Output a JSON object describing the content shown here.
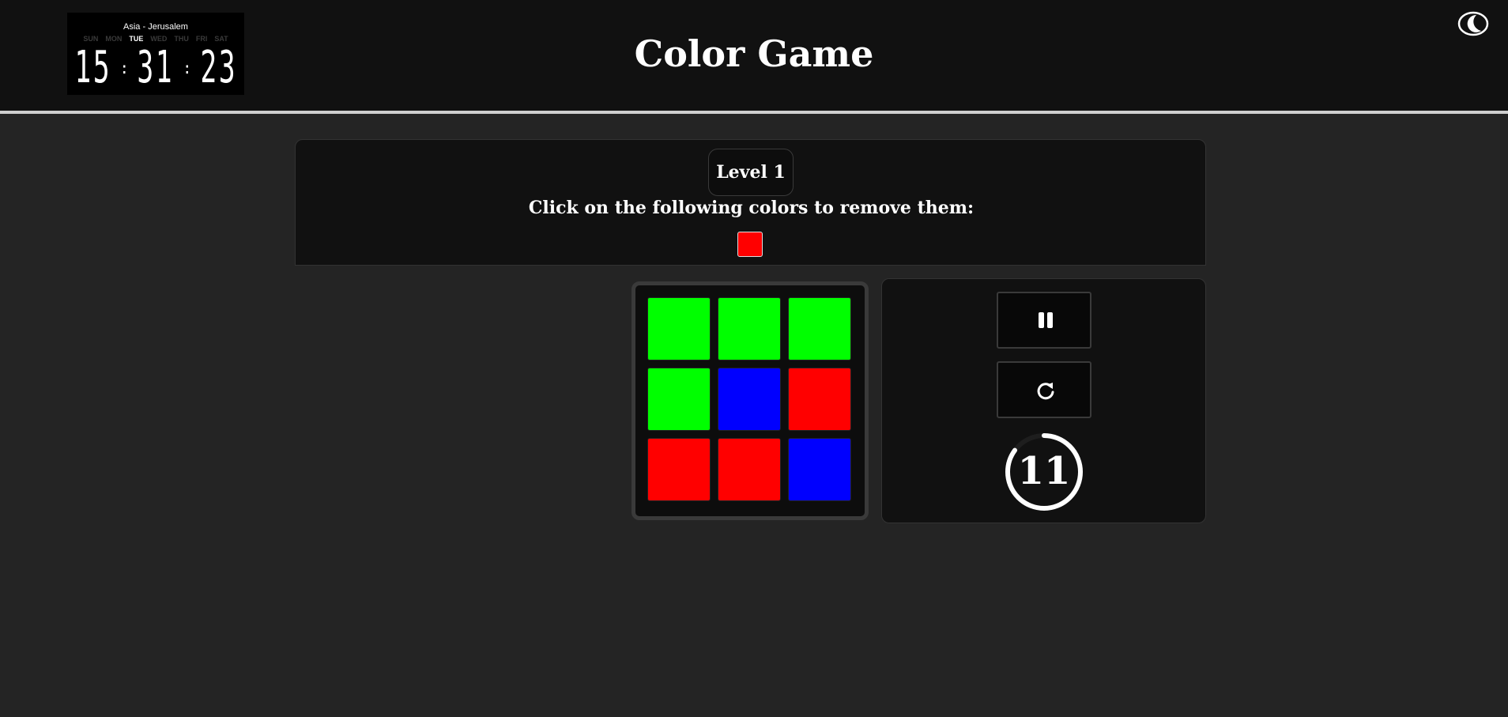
{
  "header": {
    "title": "Color Game",
    "theme_icon": "moon-icon"
  },
  "clock": {
    "timezone": "Asia - Jerusalem",
    "days": [
      "SUN",
      "MON",
      "TUE",
      "WED",
      "THU",
      "FRI",
      "SAT"
    ],
    "active_day": "TUE",
    "hours": "15",
    "minutes": "31",
    "seconds": "23"
  },
  "instructions": {
    "level_label": "Level 1",
    "text": "Click on the following colors to remove them:",
    "target_colors": [
      "#ff0000"
    ]
  },
  "board": {
    "rows": 3,
    "cols": 3,
    "tiles": [
      [
        "#00ff00",
        "#00ff00",
        "#00ff00"
      ],
      [
        "#00ff00",
        "#0000ff",
        "#ff0000"
      ],
      [
        "#ff0000",
        "#ff0000",
        "#0000ff"
      ]
    ]
  },
  "controls": {
    "pause_icon": "pause-icon",
    "restart_icon": "restart-icon",
    "timer_value": "11",
    "timer_progress": 0.85
  }
}
